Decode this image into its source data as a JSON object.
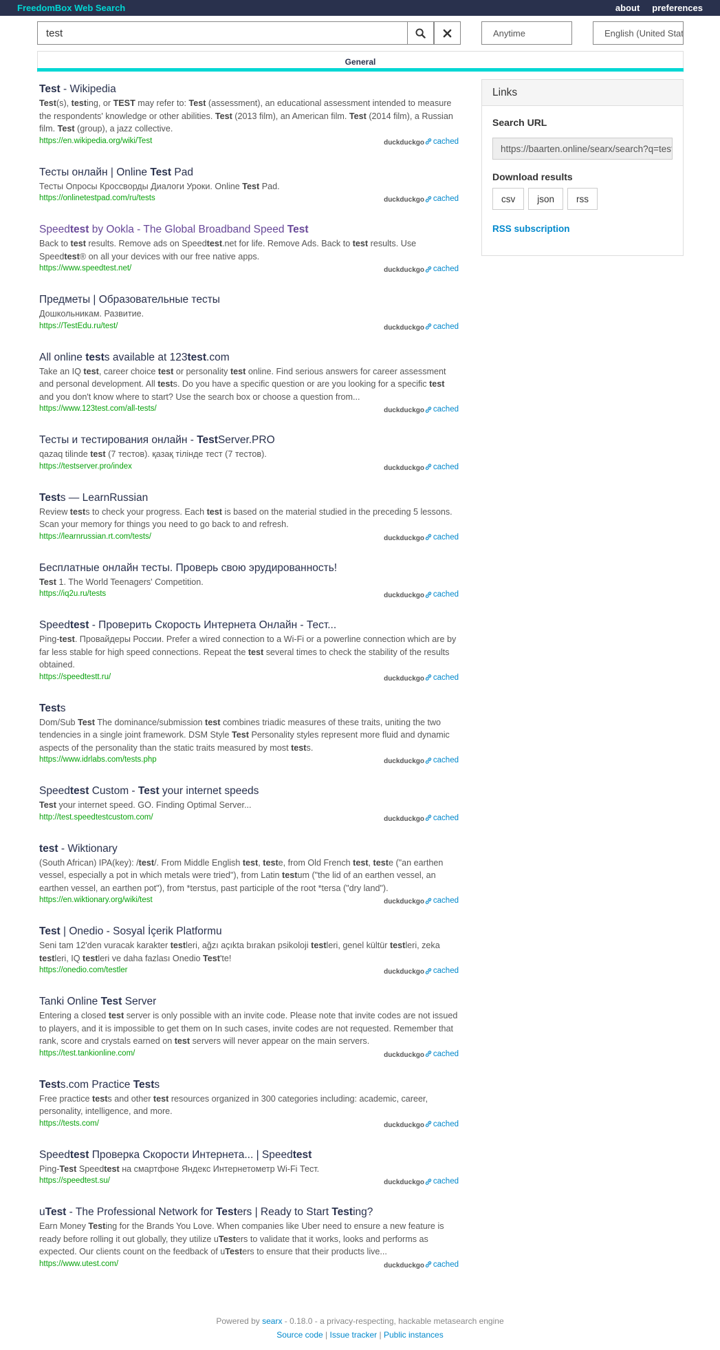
{
  "topbar": {
    "brand": "FreedomBox Web Search",
    "links": [
      "about",
      "preferences"
    ]
  },
  "search": {
    "query": "test",
    "time_range": "Anytime",
    "language": "English (United States)"
  },
  "categories": [
    "General"
  ],
  "sidebar": {
    "title": "Links",
    "search_url_label": "Search URL",
    "search_url": "https://baarten.online/searx/search?q=test",
    "download_label": "Download results",
    "formats": [
      "csv",
      "json",
      "rss"
    ],
    "rss_label": "RSS subscription"
  },
  "results": [
    {
      "title": "<b>Test</b> - Wikipedia",
      "visited": false,
      "content": "<b>Test</b>(s), <b>test</b>ing, or <b>TEST</b> may refer to: <b>Test</b> (assessment), an educational assessment intended to measure the respondents' knowledge or other abilities. <b>Test</b> (2013 film), an American film. <b>Test</b> (2014 film), a Russian film. <b>Test</b> (group), a jazz collective.",
      "url": "https://en.wikipedia.org/wiki/Test",
      "engine": "duckduckgo",
      "cached": "cached"
    },
    {
      "title": "Тесты онлайн | Online <b>Test</b> Pad",
      "visited": false,
      "content": "Тесты Опросы Кроссворды Диалоги Уроки. Online <b>Test</b> Pad.",
      "url": "https://onlinetestpad.com/ru/tests",
      "engine": "duckduckgo",
      "cached": "cached"
    },
    {
      "title": "Speed<b>test</b> by Ookla - The Global Broadband Speed <b>Test</b>",
      "visited": true,
      "content": "Back to <b>test</b> results. Remove ads on Speed<b>test</b>.net for life. Remove Ads. Back to <b>test</b> results. Use Speed<b>test</b>® on all your devices with our free native apps.",
      "url": "https://www.speedtest.net/",
      "engine": "duckduckgo",
      "cached": "cached"
    },
    {
      "title": "Предметы | Образовательные тесты",
      "visited": false,
      "content": "Дошкольникам. Развитие.",
      "url": "https://TestEdu.ru/test/",
      "engine": "duckduckgo",
      "cached": "cached"
    },
    {
      "title": "All online <b>test</b>s available at 123<b>test</b>.com",
      "visited": false,
      "content": "Take an IQ <b>test</b>, career choice <b>test</b> or personality <b>test</b> online. Find serious answers for career assessment and personal development. All <b>test</b>s. Do you have a specific question or are you looking for a specific <b>test</b> and you don't know where to start? Use the search box or choose a question from...",
      "url": "https://www.123test.com/all-tests/",
      "engine": "duckduckgo",
      "cached": "cached"
    },
    {
      "title": "Тесты и тестирования онлайн - <b>Test</b>Server.PRO",
      "visited": false,
      "content": "qazaq tilinde <b>test</b> (7 тестов). қазақ тілінде тест (7 тестов).",
      "url": "https://testserver.pro/index",
      "engine": "duckduckgo",
      "cached": "cached"
    },
    {
      "title": "<b>Test</b>s — LearnRussian",
      "visited": false,
      "content": "Review <b>test</b>s to check your progress. Each <b>test</b> is based on the material studied in the preceding 5 lessons. Scan your memory for things you need to go back to and refresh.",
      "url": "https://learnrussian.rt.com/tests/",
      "engine": "duckduckgo",
      "cached": "cached"
    },
    {
      "title": "Бесплатные онлайн тесты. Проверь свою эрудированность!",
      "visited": false,
      "content": "<b>Test</b> 1. The World Teenagers' Competition.",
      "url": "https://iq2u.ru/tests",
      "engine": "duckduckgo",
      "cached": "cached"
    },
    {
      "title": "Speed<b>test</b> - Проверить Скорость Интернета Онлайн - Тест...",
      "visited": false,
      "content": "Ping-<b>test</b>. Провайдеры России. Prefer a wired connection to a Wi-Fi or a powerline connection which are by far less stable for high speed connections. Repeat the <b>test</b> several times to check the stability of the results obtained.",
      "url": "https://speedtestt.ru/",
      "engine": "duckduckgo",
      "cached": "cached"
    },
    {
      "title": "<b>Test</b>s",
      "visited": false,
      "content": "Dom/Sub <b>Test</b> The dominance/submission <b>test</b> combines triadic measures of these traits, uniting the two tendencies in a single joint framework. DSM Style <b>Test</b> Personality styles represent more fluid and dynamic aspects of the personality than the static traits measured by most <b>test</b>s.",
      "url": "https://www.idrlabs.com/tests.php",
      "engine": "duckduckgo",
      "cached": "cached"
    },
    {
      "title": "Speed<b>test</b> Custom - <b>Test</b> your internet speeds",
      "visited": false,
      "content": "<b>Test</b> your internet speed. GO. Finding Optimal Server...",
      "url": "http://test.speedtestcustom.com/",
      "engine": "duckduckgo",
      "cached": "cached"
    },
    {
      "title": "<b>test</b> - Wiktionary",
      "visited": false,
      "content": "(South African) IPA(key): /<b>test</b>/. From Middle English <b>test</b>, <b>test</b>e, from Old French <b>test</b>, <b>test</b>e (\"an earthen vessel, especially a pot in which metals were tried\"), from Latin <b>test</b>um (\"the lid of an earthen vessel, an earthen vessel, an earthen pot\"), from *terstus, past participle of the root *tersa (\"dry land\").",
      "url": "https://en.wiktionary.org/wiki/test",
      "engine": "duckduckgo",
      "cached": "cached"
    },
    {
      "title": "<b>Test</b> | Onedio - Sosyal İçerik Platformu",
      "visited": false,
      "content": "Seni tam 12'den vuracak karakter <b>test</b>leri, ağzı açıkta bırakan psikoloji <b>test</b>leri, genel kültür <b>test</b>leri, zeka <b>test</b>leri, IQ <b>test</b>leri ve daha fazlası Onedio <b>Test</b>'te!",
      "url": "https://onedio.com/testler",
      "engine": "duckduckgo",
      "cached": "cached"
    },
    {
      "title": "Tanki Online <b>Test</b> Server",
      "visited": false,
      "content": "Entering a closed <b>test</b> server is only possible with an invite code. Please note that invite codes are not issued to players, and it is impossible to get them on In such cases, invite codes are not requested. Remember that rank, score and crystals earned on <b>test</b> servers will never appear on the main servers.",
      "url": "https://test.tankionline.com/",
      "engine": "duckduckgo",
      "cached": "cached"
    },
    {
      "title": "<b>Test</b>s.com Practice <b>Test</b>s",
      "visited": false,
      "content": "Free practice <b>test</b>s and other <b>test</b> resources organized in 300 categories including: academic, career, personality, intelligence, and more.",
      "url": "https://tests.com/",
      "engine": "duckduckgo",
      "cached": "cached"
    },
    {
      "title": "Speed<b>test</b> Проверка Скорости Интернета... | Speed<b>test</b>",
      "visited": false,
      "content": "Ping-<b>Test</b> Speed<b>test</b> на смартфоне Яндекс Интернетометр Wi-Fi Тест.",
      "url": "https://speedtest.su/",
      "engine": "duckduckgo",
      "cached": "cached"
    },
    {
      "title": "u<b>Test</b> - The Professional Network for <b>Test</b>ers | Ready to Start <b>Test</b>ing?",
      "visited": false,
      "content": "Earn Money <b>Test</b>ing for the Brands You Love. When companies like Uber need to ensure a new feature is ready before rolling it out globally, they utilize u<b>Test</b>ers to validate that it works, looks and performs as expected. Our clients count on the feedback of u<b>Test</b>ers to ensure that their products live...",
      "url": "https://www.utest.com/",
      "engine": "duckduckgo",
      "cached": "cached"
    }
  ],
  "footer": {
    "powered_by": "Powered by",
    "searx": "searx",
    "tagline": "- 0.18.0 - a privacy-respecting, hackable metasearch engine",
    "links": [
      "Source code",
      "Issue tracker",
      "Public instances"
    ]
  },
  "colors": {
    "topbar": "#29314d",
    "brand": "#01d7d4",
    "url": "#08a10c",
    "link": "#0088cc",
    "visited": "#684898"
  }
}
